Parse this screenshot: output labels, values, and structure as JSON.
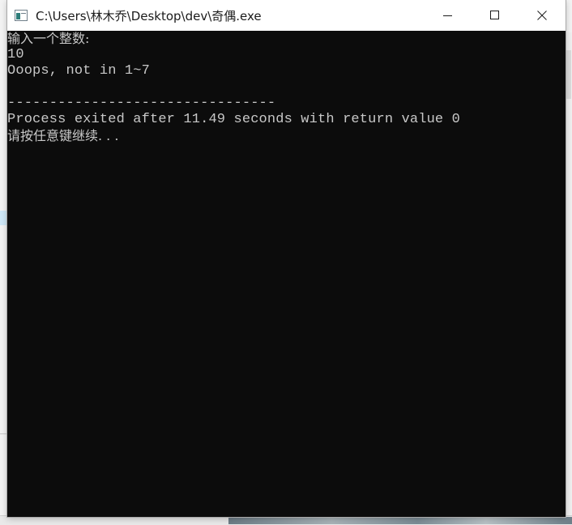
{
  "window": {
    "title": "C:\\Users\\林木乔\\Desktop\\dev\\奇偶.exe",
    "icon": "console-app-icon",
    "controls": {
      "minimize": "minimize-icon",
      "maximize": "maximize-icon",
      "close": "close-icon"
    }
  },
  "console": {
    "background": "#0c0c0c",
    "text_color": "#c8c8c8",
    "lines": [
      "输入一个整数:",
      "10",
      "Ooops, not in 1~7",
      "",
      "--------------------------------",
      "Process exited after 11.49 seconds with return value 0",
      "请按任意键继续. . ."
    ]
  }
}
